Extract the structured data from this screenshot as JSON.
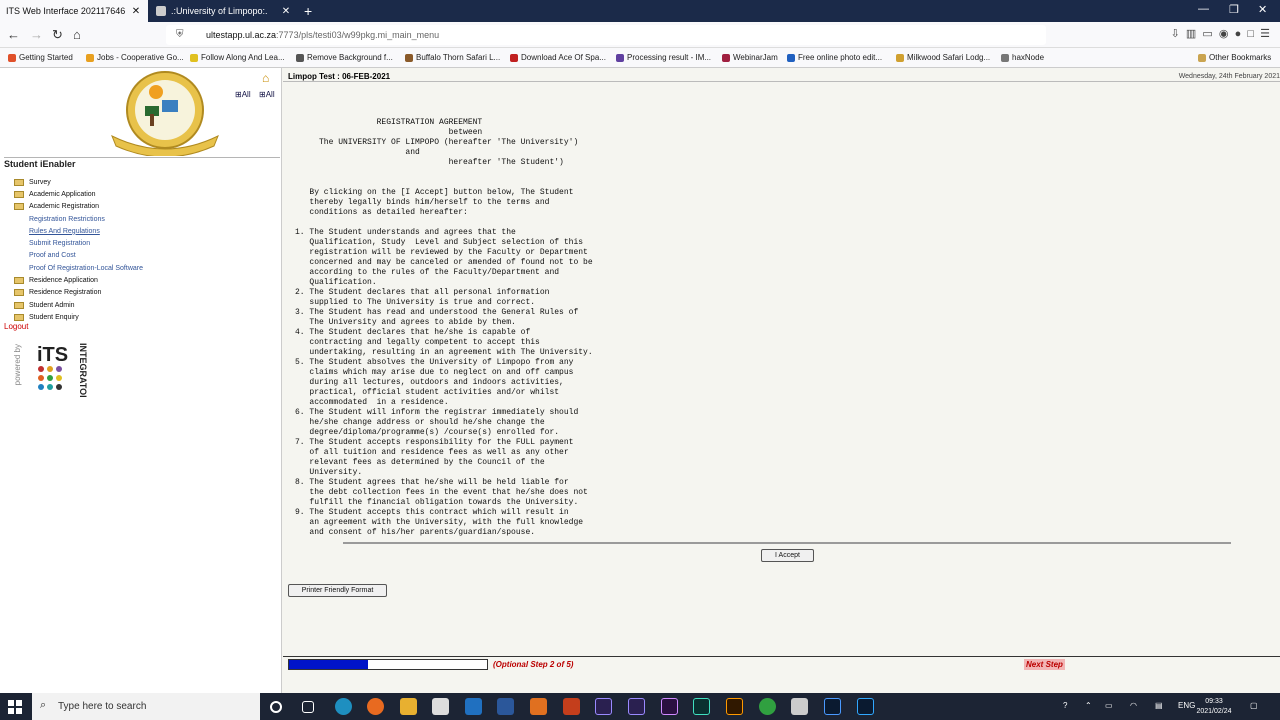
{
  "browser": {
    "tabs": [
      {
        "label": "ITS Web Interface 202117646",
        "active": true
      },
      {
        "label": ".:University of Limpopo:.",
        "active": false
      }
    ],
    "url_host": "ultestapp.ul.ac.za",
    "url_rest": ":7773/pls/testi03/w99pkg.mi_main_menu",
    "bookmarks": [
      "Getting Started",
      "Jobs - Cooperative Go...",
      "Follow Along And Lea...",
      "Remove Background f...",
      "Buffalo Thorn Safari L...",
      "Download Ace Of Spa...",
      "Processing result - IM...",
      "WebinarJam",
      "Free online photo edit...",
      "Milkwood Safari Lodg...",
      "haxNode"
    ],
    "other_bookmarks": "Other Bookmarks"
  },
  "sidebar": {
    "all_label_1": "All",
    "all_label_2": "All",
    "title": "Student iEnabler",
    "menu": [
      {
        "label": "Survey",
        "type": "folder"
      },
      {
        "label": "Academic Application",
        "type": "folder"
      },
      {
        "label": "Academic Registration",
        "type": "folder-open"
      },
      {
        "label": "Registration Restrictions",
        "type": "sub"
      },
      {
        "label": "Rules And Regulations",
        "type": "sub-underline"
      },
      {
        "label": "Submit Registration",
        "type": "sub"
      },
      {
        "label": "Proof and Cost",
        "type": "sub"
      },
      {
        "label": "Proof Of Registration-Local Software",
        "type": "sub"
      },
      {
        "label": "Residence Application",
        "type": "folder"
      },
      {
        "label": "Residence Registration",
        "type": "folder"
      },
      {
        "label": "Student Admin",
        "type": "folder"
      },
      {
        "label": "Student Enquiry",
        "type": "folder"
      }
    ],
    "logout": "Logout",
    "powered_by": "powered by",
    "its_logo_text": "iTS",
    "integrator": "INTEGRATOR"
  },
  "main": {
    "header": "Limpop Test : 06-FEB-2021",
    "date": "Wednesday, 24th February 2021",
    "agreement_text": "                 REGISTRATION AGREEMENT\n                                between\n     The UNIVERSITY OF LIMPOPO (hereafter 'The University')\n                       and\n                                hereafter 'The Student')\n\n\n   By clicking on the [I Accept] button below, The Student\n   thereby legally binds him/herself to the terms and\n   conditions as detailed hereafter:\n\n1. The Student understands and agrees that the\n   Qualification, Study  Level and Subject selection of this\n   registration will be reviewed by the Faculty or Department\n   concerned and may be canceled or amended of found not to be\n   according to the rules of the Faculty/Department and\n   Qualification.\n2. The Student declares that all personal information\n   supplied to The University is true and correct.\n3. The Student has read and understood the General Rules of\n   The University and agrees to abide by them.\n4. The Student declares that he/she is capable of\n   contracting and legally competent to accept this\n   undertaking, resulting in an agreement with The University.\n5. The Student absolves the University of Limpopo from any\n   claims which may arise due to neglect on and off campus\n   during all lectures, outdoors and indoors activities,\n   practical, official student activities and/or whilst\n   accommodated  in a residence.\n6. The Student will inform the registrar immediately should\n   he/she change address or should he/she change the\n   degree/diploma/programme(s) /course(s) enrolled for.\n7. The Student accepts responsibility for the FULL payment\n   of all tuition and residence fees as well as any other\n   relevant fees as determined by the Council of the\n   University.\n8. The Student agrees that he/she will be held liable for\n   the debt collection fees in the event that he/she does not\n   fulfill the financial obligation towards the University.\n9. The Student accepts this contract which will result in\n   an agreement with the University, with the full knowledge\n   and consent of his/her parents/guardian/spouse.",
    "accept_button": "I Accept",
    "printer_button": "Printer Friendly Format",
    "progress_fraction": 0.4,
    "step_text": "(Optional Step 2 of 5)",
    "next_step": "Next Step"
  },
  "taskbar": {
    "search_placeholder": "Type here to search",
    "lang": "ENG",
    "time": "09:33",
    "date": "2021/02/24"
  }
}
